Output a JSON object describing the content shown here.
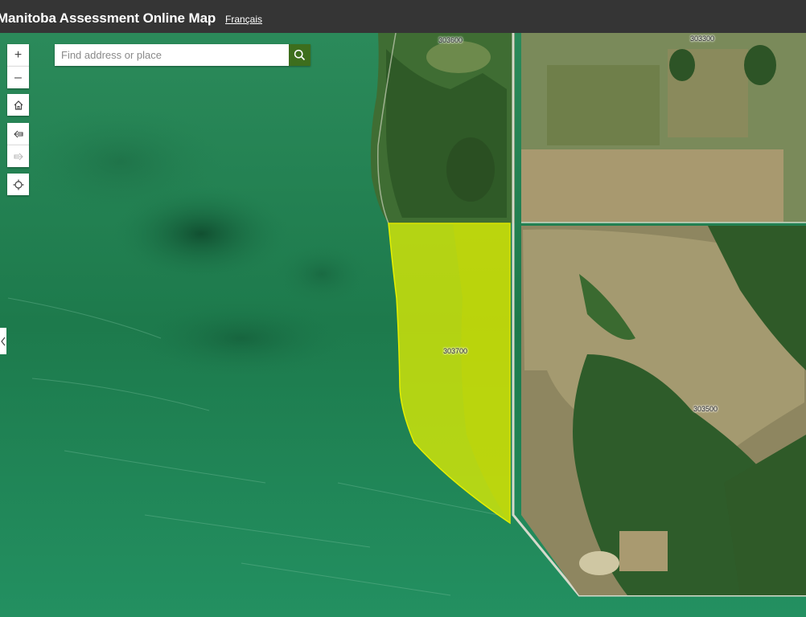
{
  "header": {
    "title": "Manitoba Assessment Online Map",
    "language_link": "Français"
  },
  "search": {
    "placeholder": "Find address or place"
  },
  "controls": {
    "zoom_in": "+",
    "zoom_out": "–"
  },
  "parcels": [
    {
      "id": "303600"
    },
    {
      "id": "303300"
    },
    {
      "id": "303700",
      "selected": true
    },
    {
      "id": "303500"
    }
  ],
  "colors": {
    "header_bg": "#353535",
    "search_button": "#3d6e1d",
    "selection_fill": "#e6f000",
    "water": "#1f7a4f"
  }
}
